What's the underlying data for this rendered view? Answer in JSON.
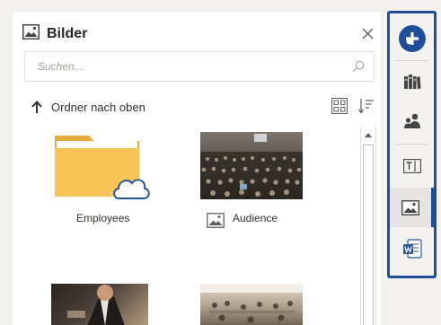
{
  "pane": {
    "title": "Bilder",
    "search_placeholder": "Suchen...",
    "up_label": "Ordner nach oben"
  },
  "items": [
    {
      "label": "Employees",
      "type": "folder"
    },
    {
      "label": "Audience",
      "type": "image"
    },
    {
      "label": "",
      "type": "image"
    },
    {
      "label": "",
      "type": "image"
    }
  ],
  "rail": {
    "items": [
      "add-icon",
      "library-icon",
      "people-icon",
      "text-field-icon",
      "image-icon",
      "word-icon"
    ],
    "active": "image-icon"
  },
  "colors": {
    "accent": "#1f4e9a",
    "folder": "#f8c458",
    "word": "#2b579a"
  }
}
